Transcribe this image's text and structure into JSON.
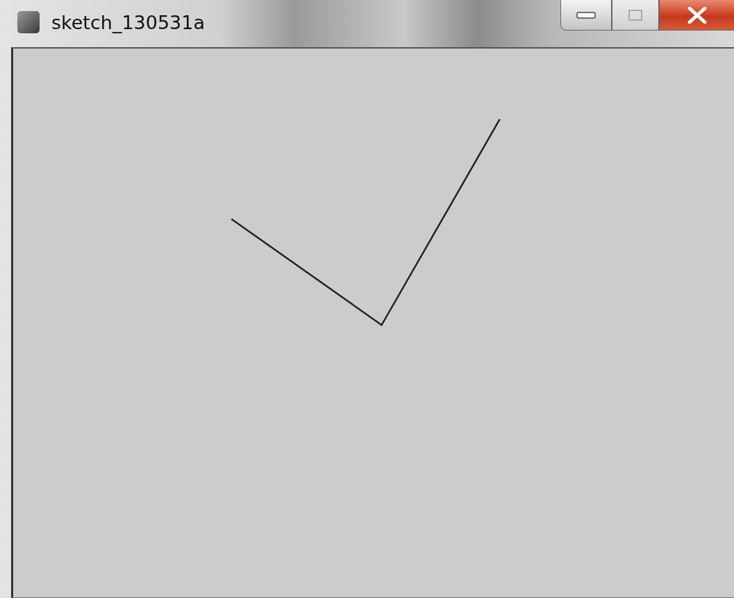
{
  "window": {
    "title": "sketch_130531a"
  }
}
